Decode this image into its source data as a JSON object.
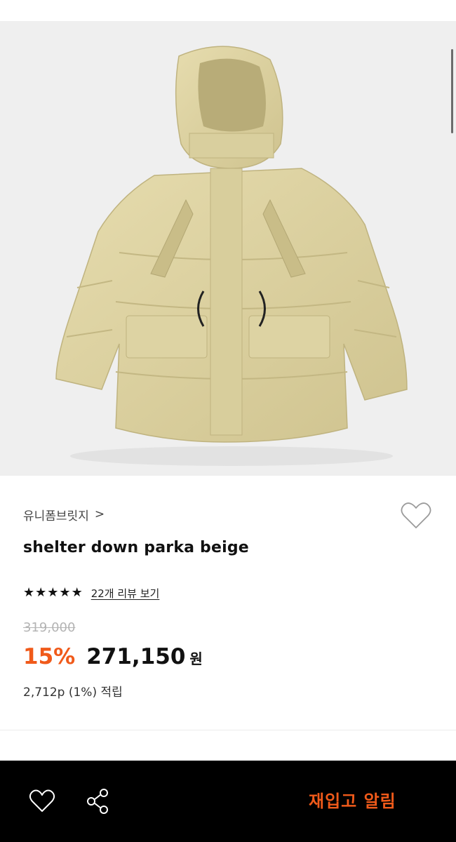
{
  "product": {
    "image_alt": "shelter down parka beige",
    "brand": "유니폼브릿지",
    "brand_chevron": ">",
    "title": "shelter down parka beige",
    "rating_stars": 5,
    "review_link": "22개 리뷰 보기",
    "original_price": "319,000",
    "discount": "15%",
    "price": "271,150",
    "currency": "원",
    "points": "2,712p (1%) 적립"
  },
  "icons": {
    "wishlist": "heart-outline-icon",
    "share": "share-icon",
    "star": "star-icon"
  },
  "bottom_bar": {
    "restock_label": "재입고 알림"
  },
  "colors": {
    "accent": "#f05a1a",
    "image_bg": "#efefef",
    "bottom_bar_bg": "#000000"
  }
}
